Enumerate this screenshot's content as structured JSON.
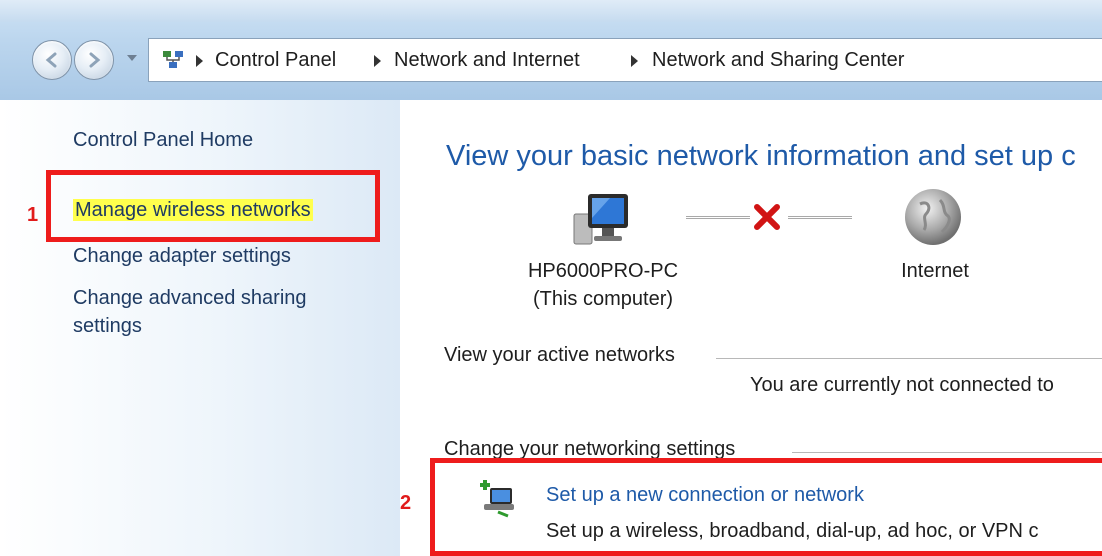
{
  "breadcrumb": {
    "items": [
      "Control Panel",
      "Network and Internet",
      "Network and Sharing Center"
    ]
  },
  "sidebar": {
    "home": "Control Panel Home",
    "links": [
      "Manage wireless networks",
      "Change adapter settings",
      "Change advanced sharing",
      "settings"
    ]
  },
  "annotations": {
    "one": "1",
    "two": "2",
    "color": "#ee1c1c",
    "highlight": "#ffff4d"
  },
  "main": {
    "heading": "View your basic network information and set up c",
    "computer_name": "HP6000PRO-PC",
    "computer_note": "(This computer)",
    "internet_label": "Internet",
    "connection_status": "disconnected",
    "active_networks_header": "View your active networks",
    "not_connected_text": "You are currently not connected to",
    "settings_header": "Change your networking settings",
    "setup_link": "Set up a new connection or network",
    "setup_desc": "Set up a wireless, broadband, dial-up, ad hoc, or VPN c"
  },
  "icons": [
    "back-arrow-icon",
    "forward-arrow-icon",
    "network-folder-icon",
    "computer-icon",
    "red-x-icon",
    "globe-icon",
    "new-connection-icon"
  ]
}
